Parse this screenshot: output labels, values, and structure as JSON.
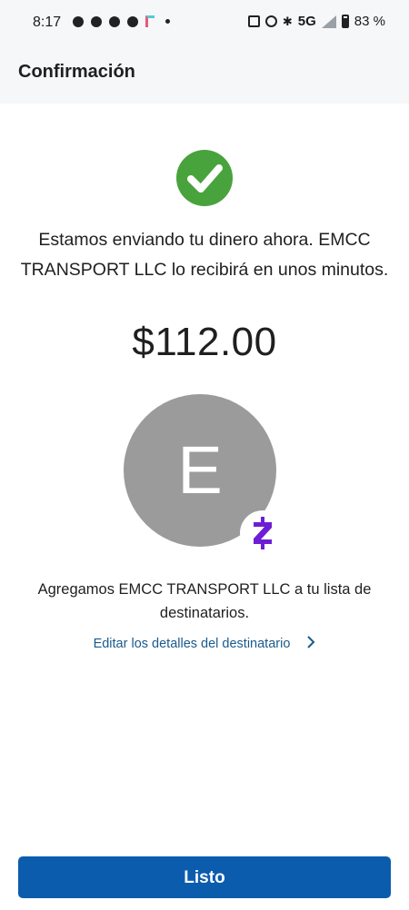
{
  "status_bar": {
    "time": "8:17",
    "network": "5G",
    "battery": "83 %",
    "icons": [
      "facebook-icon",
      "facebook-icon",
      "person-add-icon",
      "facebook-icon",
      "tiktok-icon",
      "dot-icon",
      "nfc-icon",
      "alarm-icon",
      "bluetooth-icon",
      "signal-icon",
      "battery-icon"
    ]
  },
  "header": {
    "title": "Confirmación"
  },
  "confirmation": {
    "message": "Estamos enviando tu dinero ahora. EMCC TRANSPORT LLC lo recibirá en unos minutos.",
    "amount": "$112.00",
    "avatar_initial": "E",
    "added_text": "Agregamos EMCC TRANSPORT LLC a tu lista de destinatarios.",
    "edit_link": "Editar los detalles del destinatario"
  },
  "footer": {
    "done_label": "Listo"
  },
  "colors": {
    "success_green": "#48a33c",
    "avatar_gray": "#9b9b9b",
    "zelle_purple": "#6d1ed4",
    "link_blue": "#1a5a8c",
    "button_blue": "#0b5cad",
    "header_bg": "#f6f7f9"
  }
}
